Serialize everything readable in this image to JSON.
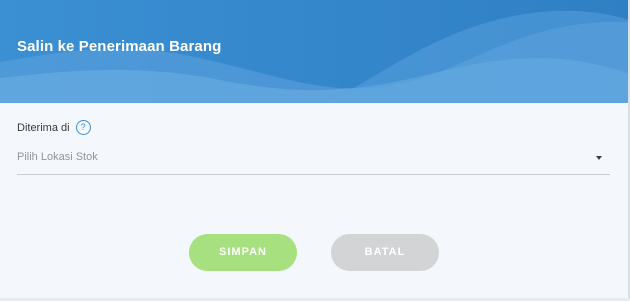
{
  "dialog": {
    "title": "Salin ke Penerimaan Barang"
  },
  "form": {
    "received_at_label": "Diterima di",
    "help_symbol": "?",
    "location_placeholder": "Pilih Lokasi Stok"
  },
  "actions": {
    "save_label": "SIMPAN",
    "cancel_label": "BATAL"
  },
  "colors": {
    "header_primary": "#3a8cd0",
    "save_button": "#a7e07f",
    "cancel_button": "#d3d4d6",
    "help_icon": "#3d8fd1"
  },
  "icons": {
    "help": "question-circle-icon",
    "dropdown": "caret-down-icon"
  }
}
